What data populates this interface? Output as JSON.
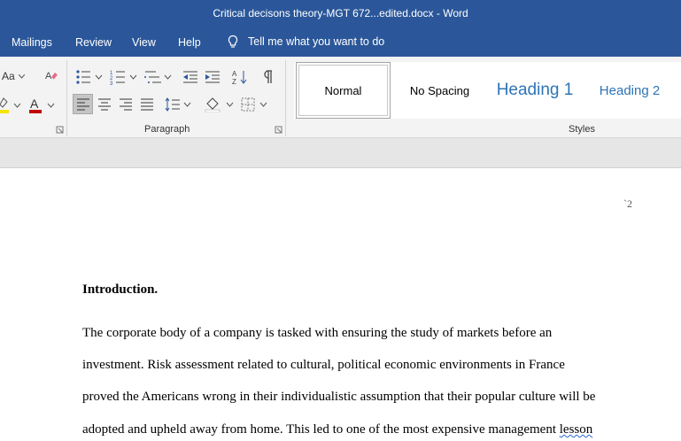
{
  "window": {
    "title": "Critical decisons theory-MGT 672...edited.docx  -  Word"
  },
  "menu": {
    "tabs": [
      "Mailings",
      "Review",
      "View",
      "Help"
    ],
    "tell_me": "Tell me what you want to do"
  },
  "ribbon": {
    "font_group": {
      "change_case_label": "Aa"
    },
    "paragraph_group": {
      "label": "Paragraph"
    },
    "styles_group": {
      "label": "Styles",
      "items": [
        "Normal",
        "No Spacing",
        "Heading 1",
        "Heading 2"
      ],
      "selected": "Normal"
    },
    "colors": {
      "highlight": "#f5e400",
      "font_color": "#c00000",
      "heading_blue": "#2e74b5"
    }
  },
  "document": {
    "page_number": "`2",
    "heading": "Introduction.",
    "paragraph_lines": [
      "The corporate body of a company is tasked with ensuring the study of markets before an",
      "investment. Risk assessment related to cultural, political economic environments in France",
      "proved the Americans wrong in their individualistic assumption that their popular culture will be",
      "adopted and upheld away from home. This led to one of the most expensive management "
    ],
    "squiggle_word": "lesson"
  }
}
